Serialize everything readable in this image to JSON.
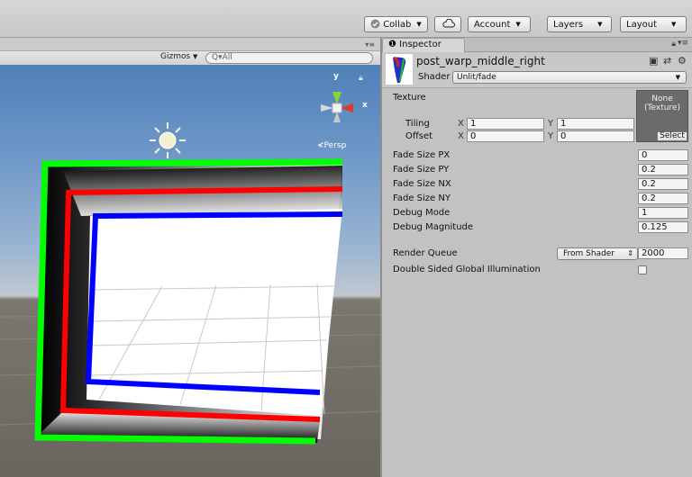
{
  "toolbar": {
    "collab": "Collab",
    "account": "Account",
    "layers": "Layers",
    "layout": "Layout"
  },
  "scene": {
    "gizmos": "Gizmos",
    "search_placeholder": "All",
    "persp_label": "Persp",
    "axis_x": "x",
    "axis_y": "y"
  },
  "inspector": {
    "tab_label": "Inspector",
    "material_name": "post_warp_middle_right",
    "shader_label": "Shader",
    "shader_value": "Unlit/fade",
    "texture": {
      "label": "Texture",
      "slot_text": "None\n(Texture)",
      "select": "Select",
      "tiling_label": "Tiling",
      "offset_label": "Offset",
      "tiling_x": "1",
      "tiling_y": "1",
      "offset_x": "0",
      "offset_y": "0",
      "x_label": "X",
      "y_label": "Y"
    },
    "properties": [
      {
        "label": "Fade Size PX",
        "value": "0"
      },
      {
        "label": "Fade Size PY",
        "value": "0.2"
      },
      {
        "label": "Fade Size NX",
        "value": "0.2"
      },
      {
        "label": "Fade Size NY",
        "value": "0.2"
      },
      {
        "label": "Debug Mode",
        "value": "1"
      },
      {
        "label": "Debug Magnitude",
        "value": "0.125"
      }
    ],
    "render_queue": {
      "label": "Render Queue",
      "mode": "From Shader",
      "value": "2000"
    },
    "double_sided_gi": {
      "label": "Double Sided Global Illumination",
      "checked": false
    }
  },
  "colors": {
    "frame_outer": "#00ff00",
    "frame_middle": "#ff0000",
    "frame_inner": "#0000ff",
    "sky": "#6e98c8",
    "ground": "#6a655f"
  }
}
